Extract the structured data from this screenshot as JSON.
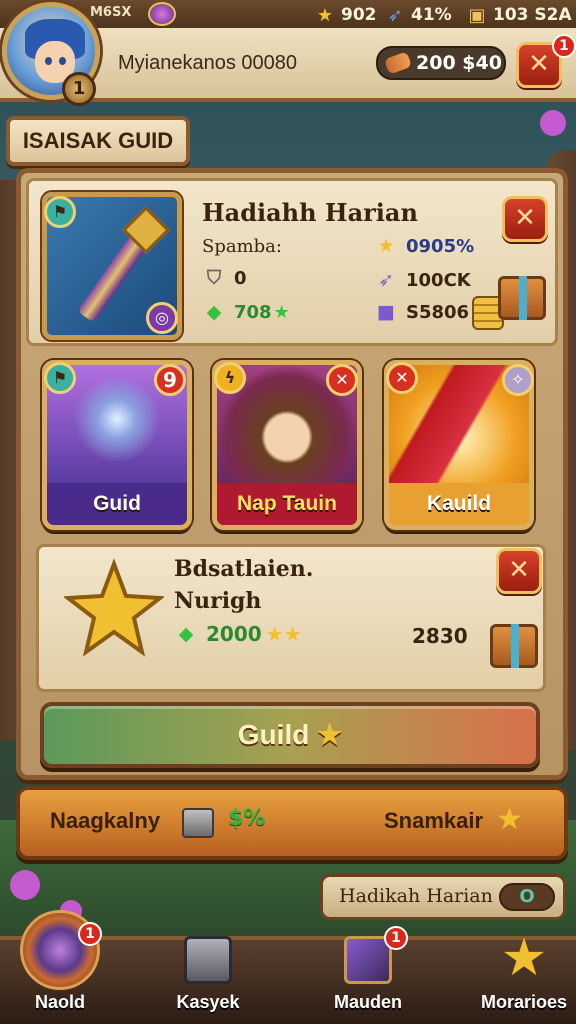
{
  "topbar": {
    "level_text": "M6SX",
    "resources": [
      {
        "icon": "star-icon",
        "value": "902"
      },
      {
        "icon": "feather-icon",
        "value": "41%"
      },
      {
        "icon": "scroll-icon",
        "value": "103 S2A"
      }
    ]
  },
  "player": {
    "name": "Myianekanos 00080",
    "level": "1",
    "currency": "200 $40"
  },
  "guild_tab": "ISAISAK GUID",
  "daily": {
    "title": "Hadiahh Harian",
    "subtitle": "Spamba:",
    "stat_a": "0",
    "stat_b": "708",
    "stat_c": "0905%",
    "stat_d": "100CK",
    "stat_e": "S5806"
  },
  "cards": [
    {
      "label": "Guid",
      "badge": "9"
    },
    {
      "label": "Nap Tauin",
      "badge": ""
    },
    {
      "label": "Kauild",
      "badge": ""
    }
  ],
  "achievement": {
    "title": "Bdsatlaien.",
    "subtitle": "Nurigh",
    "value": "2000",
    "count": "2830"
  },
  "guild_button": "Guild",
  "bottom": {
    "left": "Naagkalny",
    "mid": "$%",
    "right": "Snamkair"
  },
  "daily_pill": {
    "label": "Hadikah Harian",
    "toggle": "O"
  },
  "nav": [
    {
      "label": "Naold",
      "icon": "wand-icon",
      "badge": "1"
    },
    {
      "label": "Kasyek",
      "icon": "chest-icon",
      "badge": ""
    },
    {
      "label": "Mauden",
      "icon": "scroll-icon",
      "badge": "1"
    },
    {
      "label": "Morarioes",
      "icon": "star-icon",
      "badge": ""
    }
  ],
  "header_badge": "1",
  "colors": {
    "accent_gold": "#d8b060",
    "panel_wood": "#8a5a30",
    "close_red": "#d8402a"
  }
}
